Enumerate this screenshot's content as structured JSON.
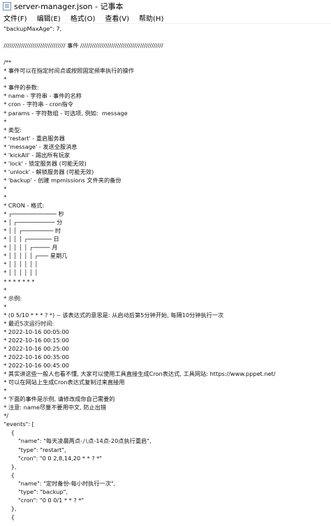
{
  "window": {
    "title": "server-manager.json - 记事本"
  },
  "menubar": {
    "items": [
      "文件(F)",
      "编辑(E)",
      "格式(O)",
      "查看(V)",
      "帮助(H)"
    ]
  },
  "editor": {
    "lines": [
      "  \"backupMaxAge\": 7,",
      "",
      "  //////////////////////////////// 事件 ///////////////////////////////////////////",
      "",
      "  /**",
      "  * 事件可以在指定时间点或按照固定频率执行的操作",
      "  *",
      "  * 事件的参数:",
      "  * name - 字符串 - 事件的名称",
      "  * cron - 字符串 - cron指令",
      "  * params - 字符数组 - 可选项, 例如:  message",
      "  *",
      "  * 类型:",
      "  * 'restart' - 重启服务器",
      "  * 'message' - 发送全服消息",
      "  * 'kickAll' - 踢出所有玩家",
      "  * 'lock' - 锁定服务器 (可能无效)",
      "  * 'unlock' - 解锁服务器 (可能无效)",
      "  * 'backup' - 创建 mpmissions 文件夹的备份",
      "  *",
      "  *",
      "  * CRON - 格式:",
      "  * ┌───────────── 秒",
      "  * │ ┌─────────── 分",
      "  * │ │ ┌───────── 时",
      "  * │ │ │ ┌─────── 日",
      "  * │ │ │ │ ┌───── 月",
      "  * │ │ │ │ │ ┌─── 星期几",
      "  * │ │ │ │ │ │",
      "  * │ │ │ │ │ │",
      "  * * * * * * *",
      "  *",
      "  * 示例:",
      "  *",
      "  * (0 5/10 * * * ? *) -- 该表达式的意思是: 从启动后第5分钟开始, 每隔10分钟执行一次",
      "  * 最近5次运行时间:",
      "  * 2022-10-16 00:05:00",
      "  * 2022-10-16 00:15:00",
      "  * 2022-10-16 00:25:00",
      "  * 2022-10-16 00:35:00",
      "  * 2022-10-16 00:45:00",
      "  * 其实讲这些一般人也看不懂, 大家可以使用工具直接生成Cron表达式, 工具网站: https://www.pppet.net/",
      "  * 可以在网站上生成Cron表达式复制过来直接用",
      "  *",
      "  * 下面的事件是示例, 请修改成你自己需要的",
      "  * 注意: name尽量不要用中文, 防止出错",
      "  */",
      "  \"events\": [",
      "      {",
      "          \"name\": \"每天凌晨两点-八点-14点-20点执行重启\",",
      "          \"type\": \"restart\",",
      "          \"cron\": \"0 0 2,8,14,20 * * ? *\"",
      "      },",
      "      {",
      "          \"name\": \"定时备份-每小时执行一次\",",
      "          \"type\": \"backup\",",
      "          \"cron\": \"0 0 0/1 * * ? *\"",
      "      },",
      "      {"
    ]
  }
}
